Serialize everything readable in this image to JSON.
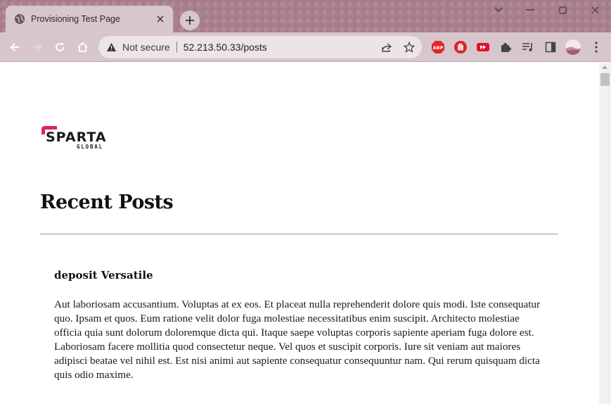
{
  "browser": {
    "tab_title": "Provisioning Test Page",
    "omnibox": {
      "security_label": "Not secure",
      "url": "52.213.50.33/posts"
    },
    "extensions": [
      "adblock-plus-icon",
      "stop-hand-icon",
      "youtube-skip-icon",
      "puzzle-extensions-icon",
      "media-queue-icon",
      "side-panel-icon",
      "profile-avatar"
    ],
    "colors": {
      "frame": "#a87f8b",
      "toolbar": "#d7c7cc",
      "omnibox": "#ede4e7"
    }
  },
  "page": {
    "logo": {
      "word": "SPARTA",
      "sub": "GLOBAL",
      "accent": "#e0245e"
    },
    "heading": "Recent Posts",
    "posts": [
      {
        "title": "deposit Versatile",
        "body": "Aut laboriosam accusantium. Voluptas at ex eos. Et placeat nulla reprehenderit dolore quis modi. Iste consequatur quo. Ipsam et quos. Eum ratione velit dolor fuga molestiae necessitatibus enim suscipit. Architecto molestiae officia quia sunt dolorum doloremque dicta qui. Itaque saepe voluptas corporis sapiente aperiam fuga dolore est. Laboriosam facere mollitia quod consectetur neque. Vel quos et suscipit corporis. Iure sit veniam aut maiores adipisci beatae vel nihil est. Est nisi animi aut sapiente consequatur consequuntur nam. Qui rerum quisquam dicta quis odio maxime."
      }
    ]
  }
}
